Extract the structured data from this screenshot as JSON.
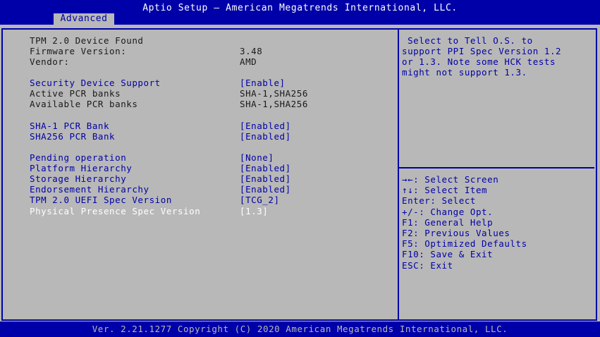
{
  "header": {
    "title": "Aptio Setup – American Megatrends International, LLC.",
    "tab": "Advanced"
  },
  "main": {
    "rows": [
      {
        "label": "TPM 2.0 Device Found",
        "value": ""
      },
      {
        "label": "Firmware Version:",
        "value": "3.48"
      },
      {
        "label": "Vendor:",
        "value": "AMD"
      },
      {
        "label": "Security Device Support",
        "value": "[Enable]"
      },
      {
        "label": "Active PCR banks",
        "value": "SHA-1,SHA256"
      },
      {
        "label": "Available PCR banks",
        "value": "SHA-1,SHA256"
      },
      {
        "label": "SHA-1 PCR Bank",
        "value": "[Enabled]"
      },
      {
        "label": "SHA256 PCR Bank",
        "value": "[Enabled]"
      },
      {
        "label": "Pending operation",
        "value": "[None]"
      },
      {
        "label": "Platform Hierarchy",
        "value": "[Enabled]"
      },
      {
        "label": "Storage Hierarchy",
        "value": "[Enabled]"
      },
      {
        "label": "Endorsement Hierarchy",
        "value": "[Enabled]"
      },
      {
        "label": "TPM 2.0 UEFI Spec Version",
        "value": "[TCG_2]"
      },
      {
        "label": "Physical Presence Spec Version",
        "value": "[1.3]"
      }
    ]
  },
  "help": {
    "text": " Select to Tell O.S. to\nsupport PPI Spec Version 1.2\nor 1.3. Note some HCK tests\nmight not support 1.3."
  },
  "keys": [
    "→←: Select Screen",
    "↑↓: Select Item",
    "Enter: Select",
    "+/-: Change Opt.",
    "F1: General Help",
    "F2: Previous Values",
    "F5: Optimized Defaults",
    "F10: Save & Exit",
    "ESC: Exit"
  ],
  "footer": {
    "text": "Ver. 2.21.1277 Copyright (C) 2020 American Megatrends International, LLC."
  },
  "colors": {
    "bios_blue": "#0000a8",
    "panel_gray": "#b8b8b8",
    "selected_text": "#ffffff"
  }
}
